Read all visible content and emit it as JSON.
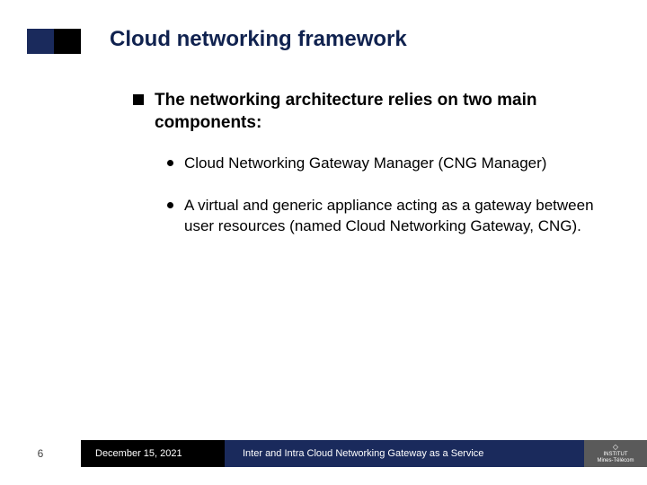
{
  "slide": {
    "title": "Cloud networking framework"
  },
  "content": {
    "intro": "The networking architecture relies on two main components:",
    "points": {
      "p1": "Cloud Networking Gateway Manager (CNG Manager)",
      "p2": "A virtual and generic appliance acting as a gateway between user resources (named Cloud Networking Gateway, CNG)."
    }
  },
  "footer": {
    "page": "6",
    "date": "December 15, 2021",
    "presentation_title": "Inter and Intra Cloud Networking Gateway as a Service",
    "logo_line1": "INSTITUT",
    "logo_line2": "Mines-Télécom"
  }
}
